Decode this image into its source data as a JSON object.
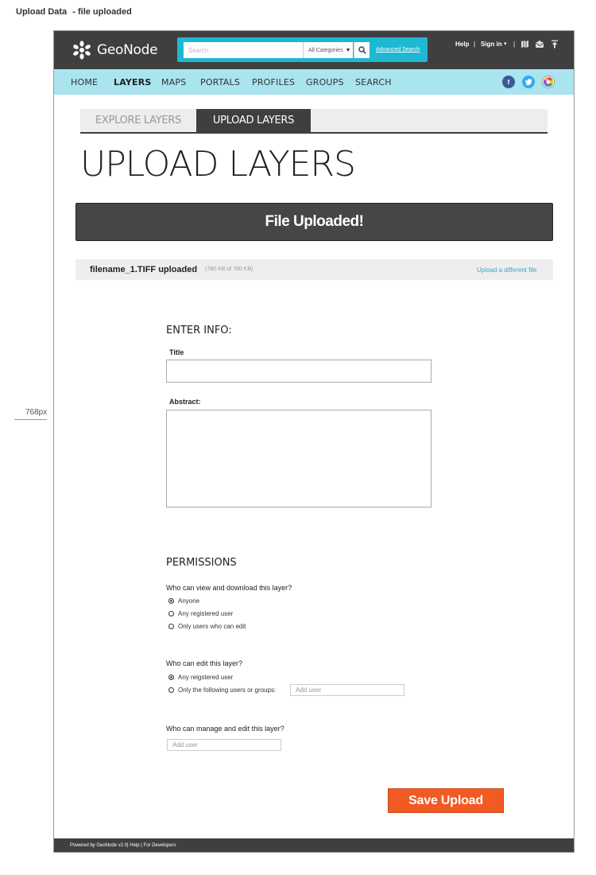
{
  "doc": {
    "title": "Upload Data",
    "subtitle": "- file uploaded",
    "ruler_label": "768px"
  },
  "header": {
    "logo_text": "GeoNode",
    "search_placeholder": "Search",
    "category_select": "All Categories",
    "advanced_search": "Advanced Search",
    "help": "Help",
    "separator": "|",
    "sign_in": "Sign in",
    "icons": [
      "map-icon",
      "mail-icon",
      "upload-icon"
    ]
  },
  "nav": {
    "items": [
      {
        "label": "HOME",
        "active": false
      },
      {
        "label": "LAYERS",
        "active": true
      },
      {
        "label": "MAPS",
        "active": false
      },
      {
        "label": "PORTALS",
        "active": false
      },
      {
        "label": "PROFILES",
        "active": false
      },
      {
        "label": "GROUPS",
        "active": false
      },
      {
        "label": "SEARCH",
        "active": false
      }
    ],
    "social": [
      {
        "icon": "facebook-icon",
        "glyph": "f",
        "color": "#3b5998"
      },
      {
        "icon": "twitter-icon",
        "glyph": "t",
        "color": "#33aaee"
      },
      {
        "icon": "google-icon",
        "glyph": "g",
        "color": "#dd4b39"
      }
    ]
  },
  "tabs": {
    "explore": "EXPLORE LAYERS",
    "upload": "UPLOAD LAYERS"
  },
  "page_title": "UPLOAD LAYERS",
  "banner": "File Uploaded!",
  "file": {
    "name": "filename_1.TIFF uploaded",
    "size": "(780 KB of 780 KB)",
    "upload_different": "Upload a different file"
  },
  "info": {
    "heading": "ENTER INFO:",
    "title_label": "Title",
    "abstract_label": "Abstract:",
    "title_value": "",
    "abstract_value": ""
  },
  "permissions": {
    "heading": "PERMISSIONS",
    "view": {
      "question": "Who can view and download this layer?",
      "options": [
        "Anyone",
        "Any registered user",
        "Only users who can edit"
      ],
      "selected": "Anyone"
    },
    "edit": {
      "question": "Who can edit this layer?",
      "options": [
        "Any reigstered user",
        "Only the following users or groups:"
      ],
      "selected": "Any reigstered user",
      "add_user_placeholder": "Add user"
    },
    "manage": {
      "question": "Who can manage and edit this layer?",
      "add_user_placeholder": "Add user"
    }
  },
  "save_button": "Save Upload",
  "footer": {
    "powered": "Powered by GeoNode v2.0",
    "help": "Help",
    "developers": "For Developers"
  },
  "colors": {
    "topbar": "#3f3f3f",
    "search_bg": "#1fb8d3",
    "navbar": "#a9e4ef",
    "accent": "#f15a22",
    "link": "#3aa6c9"
  }
}
